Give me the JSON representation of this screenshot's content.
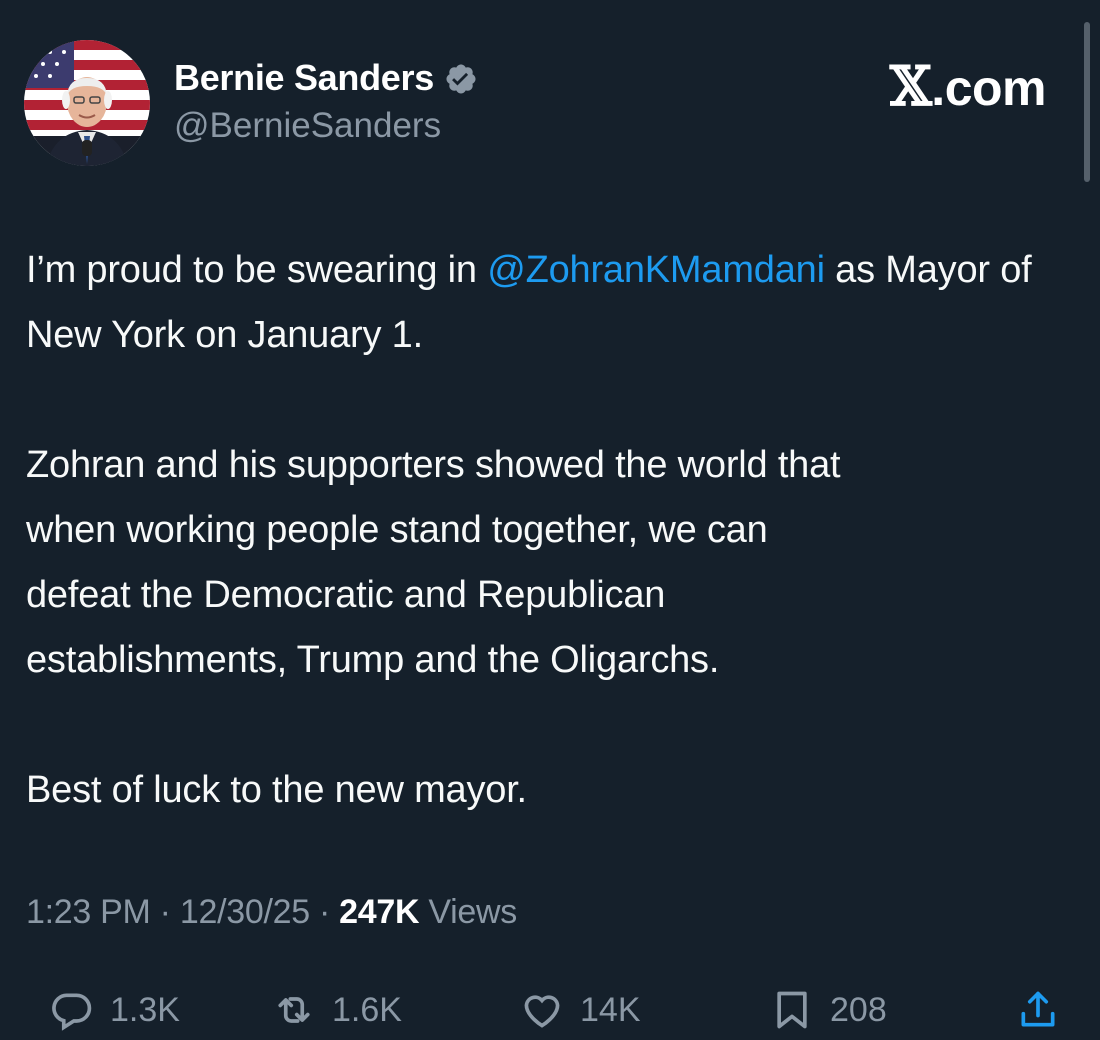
{
  "author": {
    "display_name": "Bernie Sanders",
    "handle": "@BernieSanders",
    "verified": true,
    "verified_color": "#8b98a5"
  },
  "brand": {
    "x_glyph": "𝕏",
    "suffix": ".com"
  },
  "post": {
    "p1_before": "I’m proud to be swearing in ",
    "p1_mention": "@ZohranKMamdani",
    "p1_after": " as Mayor of New York on January 1.",
    "p2_line1": "Zohran and his supporters showed the world that",
    "p2_line2": "when working people stand together, we can",
    "p2_line3": "defeat the Democratic and Republican",
    "p2_line4": "establishments, Trump and the Oligarchs.",
    "p3": "Best of luck to the new mayor."
  },
  "meta": {
    "time": "1:23 PM",
    "separator": " · ",
    "date": "12/30/25",
    "views_count": "247K",
    "views_label": " Views"
  },
  "actions": {
    "replies": "1.3K",
    "reposts": "1.6K",
    "likes": "14K",
    "bookmarks": "208"
  },
  "colors": {
    "background": "#15202b",
    "accent": "#1d9bf0",
    "secondary_text": "#8b98a5"
  }
}
